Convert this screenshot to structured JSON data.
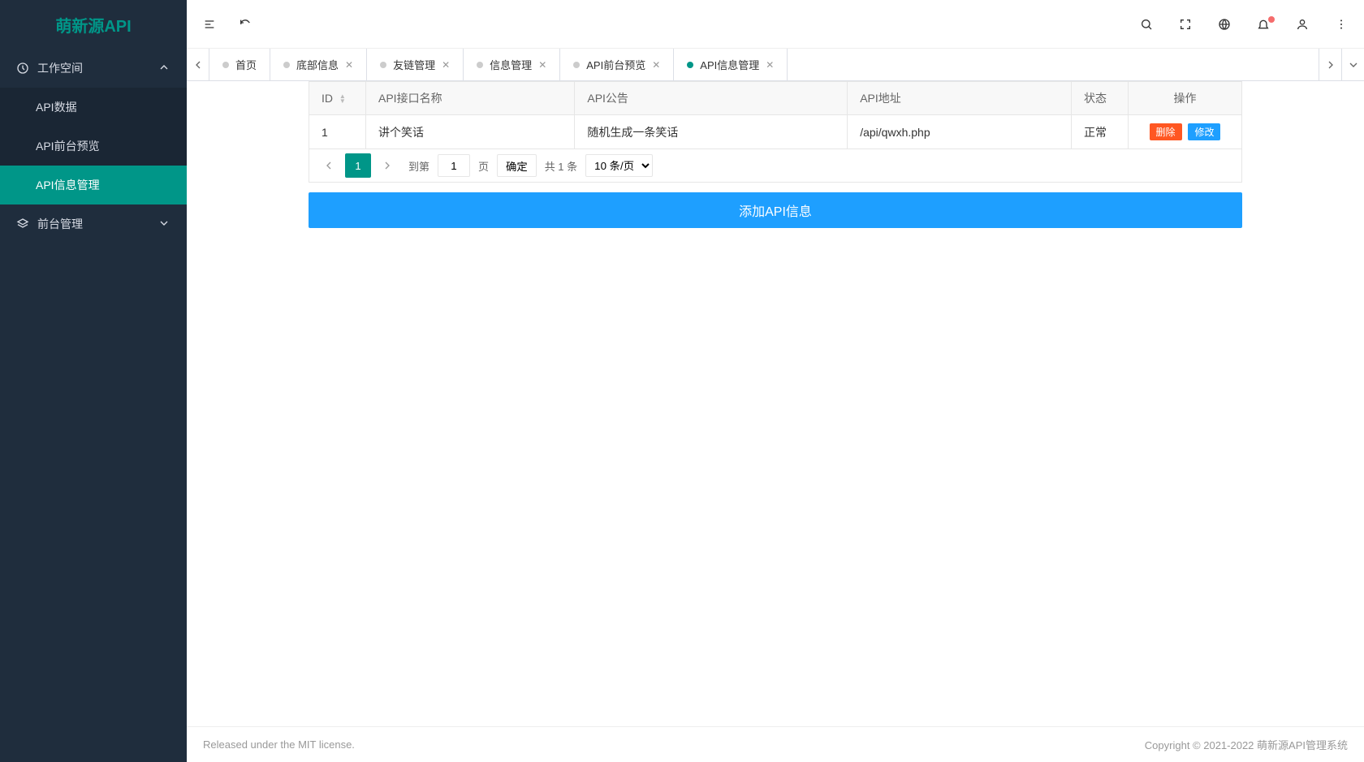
{
  "brand": "萌新源API",
  "sidebar": {
    "workspace": {
      "label": "工作空间",
      "expanded": true
    },
    "items": [
      {
        "label": "API数据"
      },
      {
        "label": "API前台预览"
      },
      {
        "label": "API信息管理",
        "active": true
      }
    ],
    "frontend": {
      "label": "前台管理",
      "expanded": false
    }
  },
  "tabs": [
    {
      "label": "首页",
      "closable": false
    },
    {
      "label": "底部信息",
      "closable": true
    },
    {
      "label": "友链管理",
      "closable": true
    },
    {
      "label": "信息管理",
      "closable": true
    },
    {
      "label": "API前台预览",
      "closable": true
    },
    {
      "label": "API信息管理",
      "closable": true,
      "active": true
    }
  ],
  "table": {
    "headers": {
      "id": "ID",
      "name": "API接口名称",
      "notice": "API公告",
      "addr": "API地址",
      "status": "状态",
      "action": "操作"
    },
    "rows": [
      {
        "id": "1",
        "name": "讲个笑话",
        "notice": "随机生成一条笑话",
        "addr": "/api/qwxh.php",
        "status": "正常"
      }
    ],
    "actions": {
      "delete": "删除",
      "edit": "修改"
    }
  },
  "pagination": {
    "current": "1",
    "goto_prefix": "到第",
    "goto_suffix": "页",
    "goto_value": "1",
    "confirm": "确定",
    "total": "共 1 条",
    "perpage": "10 条/页"
  },
  "add_button": "添加API信息",
  "footer": {
    "left": "Released under the MIT license.",
    "right_prefix": "Copyright © 2021-2022 ",
    "right_link": "萌新源API管理系统"
  }
}
